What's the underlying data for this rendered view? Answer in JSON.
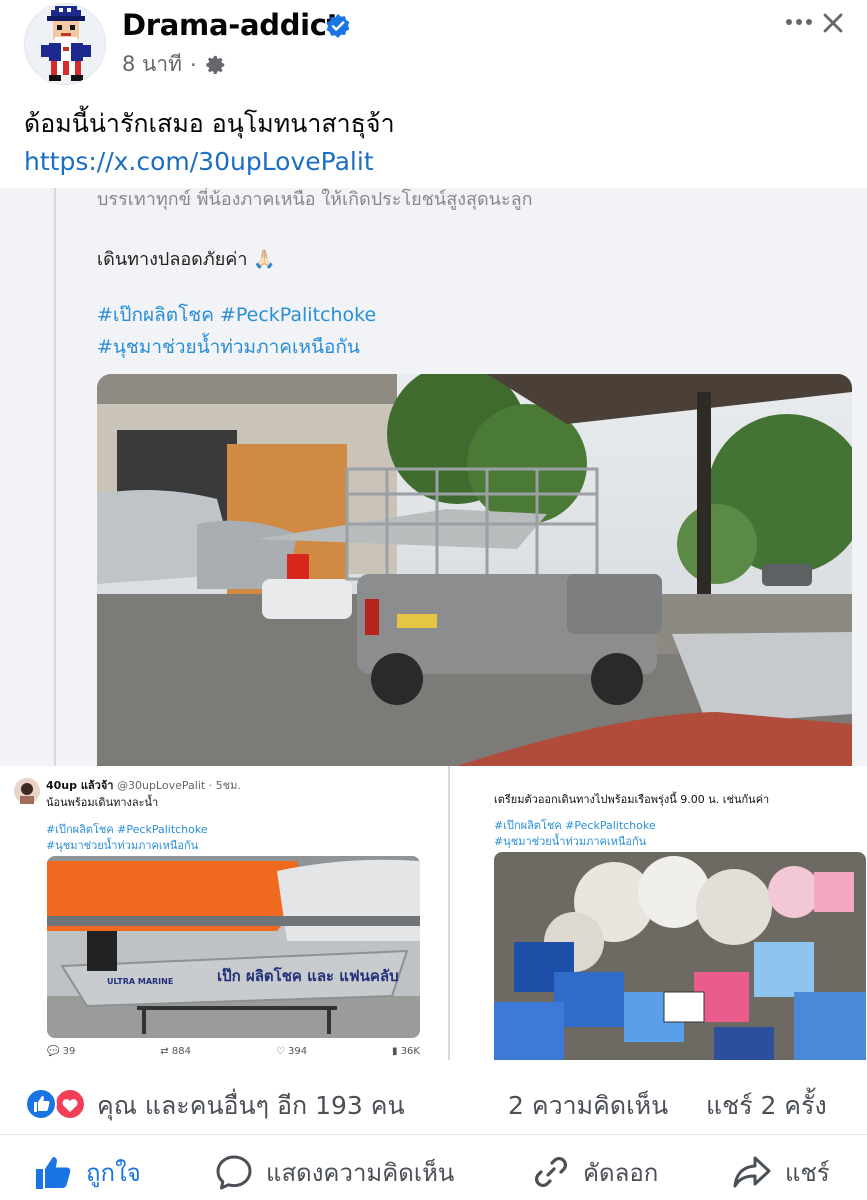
{
  "post": {
    "page_name": "Drama-addict",
    "time": "8 นาที",
    "separator": "·",
    "caption": "ด้อมนี้น่ารักเสมอ อนุโมทนาสาธุจ้า",
    "link": "https://x.com/30upLovePalit"
  },
  "embed_main": {
    "faded_line": "บรรเทาทุกข์ พี่น้องภาคเหนือ ให้เกิดประโยชน์สูงสุดนะลูก",
    "line": "เดินทางปลอดภัยค่า 🙏🏻",
    "hashtags_1": "#เป๊กผลิตโชค #PeckPalitchoke",
    "hashtags_2": "#นุชมาช่วยน้ำท่วมภาคเหนือกัน"
  },
  "embed_left": {
    "author": "40up แล้วจ้า",
    "handle": "@30upLovePalit · 5ชม.",
    "text": "น้อนพร้อมเดินทางละน้ำ",
    "hashtags_1": "#เป๊กผลิตโชค #PeckPalitchoke",
    "hashtags_2": "#นุชมาช่วยน้ำท่วมภาคเหนือกัน",
    "boat_label": "เป๊ก ผลิตโชค และ แฟนคลับ",
    "boat_brand": "ULTRA MARINE",
    "stats": {
      "replies": "39",
      "reposts": "884",
      "likes": "394",
      "views": "36K"
    }
  },
  "embed_right": {
    "text": "เตรียมตัวออกเดินทางไปพร้อมเรือพรุ่งนี้ 9.00 น. เช่นกันค่า",
    "hashtags_1": "#เป๊กผลิตโชค #PeckPalitchoke",
    "hashtags_2": "#นุชมาช่วยน้ำท่วมภาคเหนือกัน"
  },
  "reactions": {
    "summary": "คุณ และคนอื่นๆ อีก 193 คน",
    "comments": "2 ความคิดเห็น",
    "shares": "แชร์ 2 ครั้ง"
  },
  "actions": {
    "like": "ถูกใจ",
    "comment": "แสดงความคิดเห็น",
    "copy": "คัดลอก",
    "share": "แชร์"
  },
  "colors": {
    "link": "#1b6ec2",
    "like_blue": "#1b74e4",
    "love_red": "#f33e58",
    "secondary_text": "#65676b"
  },
  "icons": [
    "verified-badge-icon",
    "privacy-gear-icon",
    "more-dots-icon",
    "close-icon",
    "like-reaction-icon",
    "love-reaction-icon",
    "thumbs-up-icon",
    "comment-bubble-icon",
    "link-chain-icon",
    "share-arrow-icon"
  ]
}
